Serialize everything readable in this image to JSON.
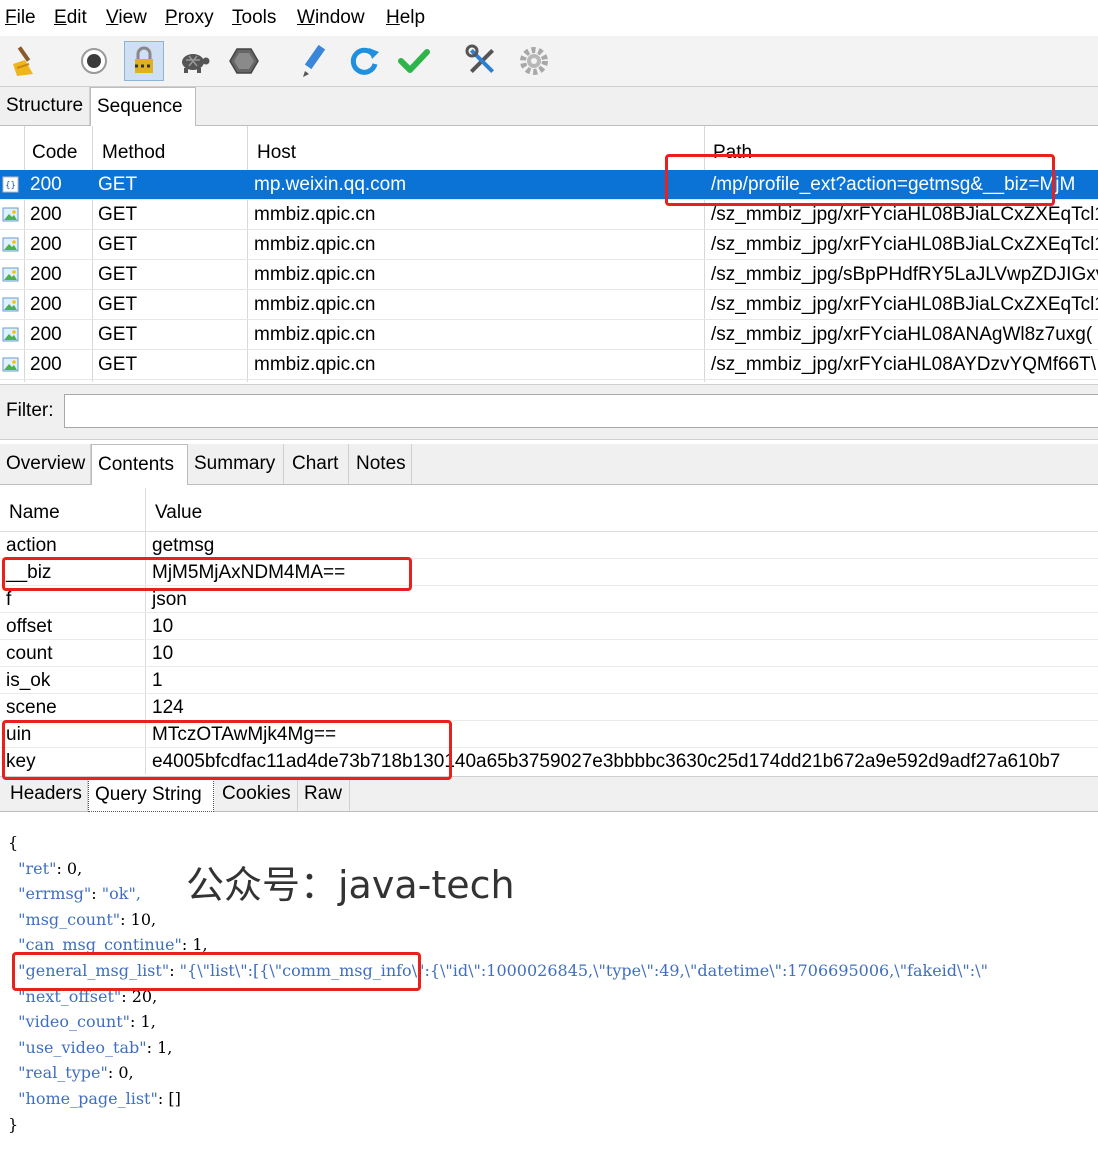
{
  "menu": [
    {
      "acc": "F",
      "rest": "ile"
    },
    {
      "acc": "E",
      "rest": "dit"
    },
    {
      "acc": "V",
      "rest": "iew"
    },
    {
      "acc": "P",
      "rest": "roxy"
    },
    {
      "acc": "T",
      "rest": "ools"
    },
    {
      "acc": "W",
      "rest": "indow"
    },
    {
      "acc": "H",
      "rest": "elp"
    }
  ],
  "toolbar": {
    "icons": [
      "broom-icon",
      "record-icon",
      "ssl-lock-icon",
      "turtle-icon",
      "hexagon-stop-icon",
      "pen-icon",
      "refresh-icon",
      "check-icon",
      "tools-icon",
      "gear-icon"
    ],
    "active": "ssl-lock-icon"
  },
  "view_tabs": {
    "structure": "Structure",
    "sequence": "Sequence",
    "selected": "Sequence"
  },
  "table": {
    "headers": {
      "code": "Code",
      "method": "Method",
      "host": "Host",
      "path": "Path"
    },
    "rows": [
      {
        "type": "json",
        "code": "200",
        "method": "GET",
        "host": "mp.weixin.qq.com",
        "path": "/mp/profile_ext?action=getmsg&__biz=MjM",
        "selected": true
      },
      {
        "type": "image",
        "code": "200",
        "method": "GET",
        "host": "mmbiz.qpic.cn",
        "path": "/sz_mmbiz_jpg/xrFYciaHL08BJiaLCxZXEqTcl1"
      },
      {
        "type": "image",
        "code": "200",
        "method": "GET",
        "host": "mmbiz.qpic.cn",
        "path": "/sz_mmbiz_jpg/xrFYciaHL08BJiaLCxZXEqTcl1"
      },
      {
        "type": "image",
        "code": "200",
        "method": "GET",
        "host": "mmbiz.qpic.cn",
        "path": "/sz_mmbiz_jpg/sBpPHdfRY5LaJLVwpZDJIGxv"
      },
      {
        "type": "image",
        "code": "200",
        "method": "GET",
        "host": "mmbiz.qpic.cn",
        "path": "/sz_mmbiz_jpg/xrFYciaHL08BJiaLCxZXEqTcl1"
      },
      {
        "type": "image",
        "code": "200",
        "method": "GET",
        "host": "mmbiz.qpic.cn",
        "path": "/sz_mmbiz_jpg/xrFYciaHL08ANAgWl8z7uxg("
      },
      {
        "type": "image",
        "code": "200",
        "method": "GET",
        "host": "mmbiz.qpic.cn",
        "path": "/sz_mmbiz_jpg/xrFYciaHL08AYDzvYQMf66T\\"
      }
    ]
  },
  "filter": {
    "label": "Filter:",
    "value": ""
  },
  "detail_tabs": {
    "items": [
      "Overview",
      "Contents",
      "Summary",
      "Chart",
      "Notes"
    ],
    "selected": "Contents"
  },
  "params": {
    "headers": {
      "name": "Name",
      "value": "Value"
    },
    "rows": [
      {
        "name": "action",
        "value": "getmsg"
      },
      {
        "name": "__biz",
        "value": "MjM5MjAxNDM4MA=="
      },
      {
        "name": "f",
        "value": "json"
      },
      {
        "name": "offset",
        "value": "10"
      },
      {
        "name": "count",
        "value": "10"
      },
      {
        "name": "is_ok",
        "value": "1"
      },
      {
        "name": "scene",
        "value": "124"
      },
      {
        "name": "uin",
        "value": "MTczOTAwMjk4Mg=="
      },
      {
        "name": "key",
        "value": "e4005bfcdfac11ad4de73b718b130140a65b3759027e3bbbbc3630c25d174dd21b672a9e592d9adf27a610b7"
      }
    ]
  },
  "content_tabs": {
    "items": [
      "Headers",
      "Query String",
      "Cookies",
      "Raw"
    ],
    "selected": "Query String"
  },
  "json_lines": [
    {
      "indent": "",
      "key": "",
      "sep": "",
      "val": "{",
      "kind": "n"
    },
    {
      "indent": "  ",
      "key": "\"ret\"",
      "sep": ": ",
      "val": "0,",
      "kind": "n"
    },
    {
      "indent": "  ",
      "key": "\"errmsg\"",
      "sep": ": ",
      "val": "\"ok\",",
      "kind": "s"
    },
    {
      "indent": "  ",
      "key": "\"msg_count\"",
      "sep": ": ",
      "val": "10,",
      "kind": "n"
    },
    {
      "indent": "  ",
      "key": "\"can_msg_continue\"",
      "sep": ": ",
      "val": "1,",
      "kind": "n"
    },
    {
      "indent": "  ",
      "key": "\"general_msg_list\"",
      "sep": ": ",
      "val": "\"{\\\"list\\\":[{\\\"comm_msg_info\\\":{\\\"id\\\":1000026845,\\\"type\\\":49,\\\"datetime\\\":1706695006,\\\"fakeid\\\":\\\"",
      "kind": "s"
    },
    {
      "indent": "  ",
      "key": "\"next_offset\"",
      "sep": ": ",
      "val": "20,",
      "kind": "n"
    },
    {
      "indent": "  ",
      "key": "\"video_count\"",
      "sep": ": ",
      "val": "1,",
      "kind": "n"
    },
    {
      "indent": "  ",
      "key": "\"use_video_tab\"",
      "sep": ": ",
      "val": "1,",
      "kind": "n"
    },
    {
      "indent": "  ",
      "key": "\"real_type\"",
      "sep": ": ",
      "val": "0,",
      "kind": "n"
    },
    {
      "indent": "  ",
      "key": "\"home_page_list\"",
      "sep": ": ",
      "val": "[]",
      "kind": "n"
    },
    {
      "indent": "",
      "key": "",
      "sep": "",
      "val": "}",
      "kind": "n"
    }
  ],
  "watermark": "公众号：java-tech",
  "colors": {
    "selection": "#0b73d6",
    "highlight": "#e8211c",
    "json_key": "#3f6fbe"
  }
}
